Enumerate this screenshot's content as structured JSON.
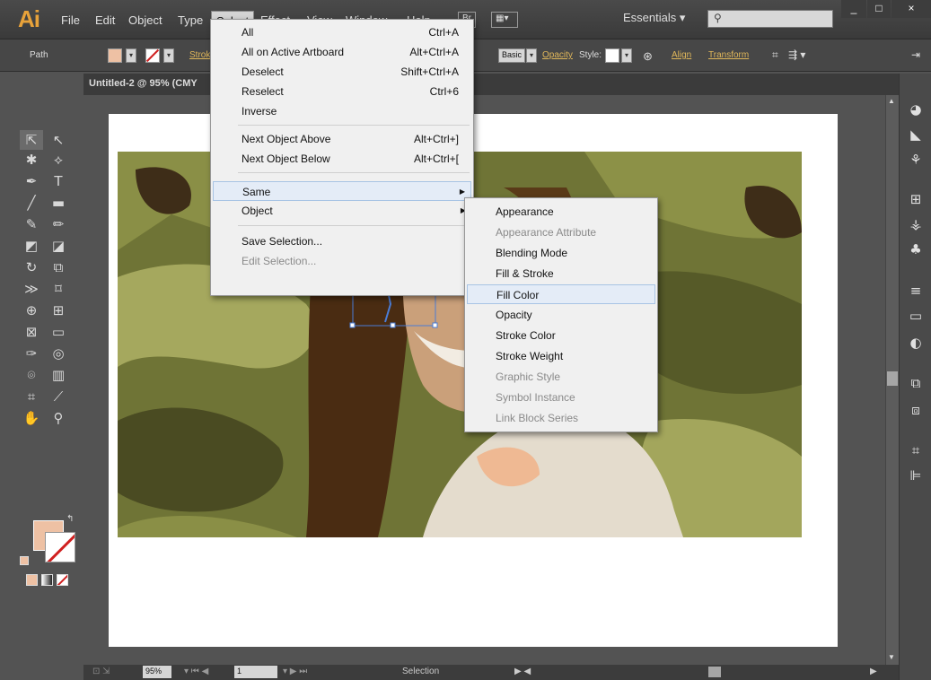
{
  "app": {
    "logo": "Ai"
  },
  "menubar": {
    "items": [
      "File",
      "Edit",
      "Object",
      "Type",
      "Select",
      "Effect",
      "View",
      "Window",
      "Help"
    ],
    "active": "Select",
    "bridge_label": "Br",
    "workspace": "Essentials",
    "window_buttons": [
      "_",
      "□",
      "×"
    ]
  },
  "controlbar": {
    "selection_type": "Path",
    "stroke_label": "Strok",
    "basic": "Basic",
    "opacity": "Opacity",
    "style": "Style:",
    "align": "Align",
    "transform": "Transform",
    "fill_color": "#eec1a4"
  },
  "document": {
    "tab_title": "Untitled-2 @ 95% (CMY"
  },
  "statusbar": {
    "zoom": "95%",
    "artboard": "1",
    "tool": "Selection"
  },
  "select_menu": {
    "items": [
      {
        "label": "All",
        "shortcut": "Ctrl+A"
      },
      {
        "label": "All on Active Artboard",
        "shortcut": "Alt+Ctrl+A"
      },
      {
        "label": "Deselect",
        "shortcut": "Shift+Ctrl+A"
      },
      {
        "label": "Reselect",
        "shortcut": "Ctrl+6"
      },
      {
        "label": "Inverse",
        "shortcut": ""
      },
      {
        "label": "Next Object Above",
        "shortcut": "Alt+Ctrl+]"
      },
      {
        "label": "Next Object Below",
        "shortcut": "Alt+Ctrl+["
      },
      {
        "label": "Same",
        "shortcut": ""
      },
      {
        "label": "Object",
        "shortcut": ""
      },
      {
        "label": "Save Selection...",
        "shortcut": ""
      },
      {
        "label": "Edit Selection...",
        "shortcut": ""
      }
    ]
  },
  "same_submenu": {
    "items": [
      {
        "label": "Appearance",
        "enabled": true
      },
      {
        "label": "Appearance Attribute",
        "enabled": false
      },
      {
        "label": "Blending Mode",
        "enabled": true
      },
      {
        "label": "Fill & Stroke",
        "enabled": true
      },
      {
        "label": "Fill Color",
        "enabled": true
      },
      {
        "label": "Opacity",
        "enabled": true
      },
      {
        "label": "Stroke Color",
        "enabled": true
      },
      {
        "label": "Stroke Weight",
        "enabled": true
      },
      {
        "label": "Graphic Style",
        "enabled": false
      },
      {
        "label": "Symbol Instance",
        "enabled": false
      },
      {
        "label": "Link Block Series",
        "enabled": false
      }
    ],
    "highlighted": "Fill Color"
  }
}
